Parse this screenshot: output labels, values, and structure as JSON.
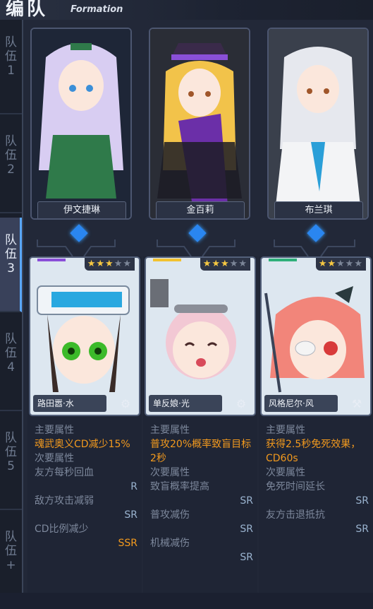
{
  "header": {
    "title_cn": "编队",
    "title_en": "Formation"
  },
  "teams": [
    "队\n伍\n1",
    "队\n伍\n2",
    "队\n伍\n3",
    "队\n伍\n4",
    "队\n伍\n5",
    "队\n伍\n+"
  ],
  "active_team_index": 2,
  "characters": [
    {
      "name": "伊文捷琳",
      "color": "#2f7a4a",
      "hair": "#d8cdf2"
    },
    {
      "name": "金百莉",
      "color": "#6b2fa8",
      "hair": "#f2c34a"
    },
    {
      "name": "布兰琪",
      "color": "#e8edf2",
      "hair": "#e6e8ee"
    }
  ],
  "equipment": [
    {
      "name": "路田嚣·水",
      "stars_filled": 3,
      "stars_total": 5,
      "rarity_color": "#8a4fd8",
      "icon": "gear-icon",
      "main_header": "主要属性",
      "main_value": "魂武奥义CD减少15%",
      "sub_header": "次要属性",
      "subs": [
        {
          "text": "友方每秒回血",
          "grade": "R"
        },
        {
          "text": "敌方攻击减弱",
          "grade": "SR"
        },
        {
          "text": "CD比例减少",
          "grade": "SSR"
        }
      ]
    },
    {
      "name": "单反娘·光",
      "stars_filled": 3,
      "stars_total": 5,
      "rarity_color": "#f2c230",
      "icon": "gear-icon",
      "main_header": "主要属性",
      "main_value": "普攻20%概率致盲目标2秒",
      "sub_header": "次要属性",
      "subs": [
        {
          "text": "致盲概率提高",
          "grade": "SR"
        },
        {
          "text": "普攻减伤",
          "grade": "SR"
        },
        {
          "text": "机械减伤",
          "grade": "SR"
        }
      ]
    },
    {
      "name": "风格尼尔·风",
      "stars_filled": 2,
      "stars_total": 5,
      "rarity_color": "#2fb07a",
      "icon": "hammer-icon",
      "main_header": "主要属性",
      "main_value": "获得2.5秒免死效果，CD60s",
      "sub_header": "次要属性",
      "subs": [
        {
          "text": "免死时间延长",
          "grade": "SR"
        },
        {
          "text": "友方击退抵抗",
          "grade": "SR"
        }
      ]
    }
  ]
}
